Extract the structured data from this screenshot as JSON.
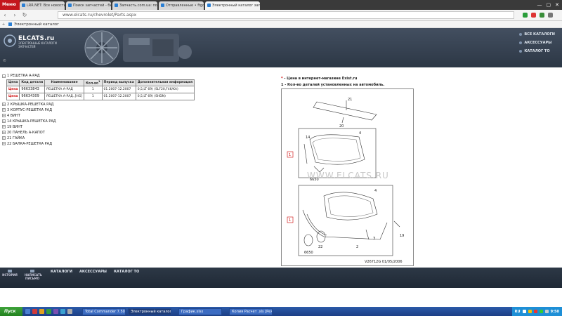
{
  "browser": {
    "brand": "Меню",
    "tabs": [
      {
        "label": "LRR.NET: Все новости м...",
        "active": false
      },
      {
        "label": "Поиск запчастей - быстрый...",
        "active": false
      },
      {
        "label": "Запчасть.com.ua: поисков...",
        "active": false
      },
      {
        "label": "Отправленные • ftgd@ukr...",
        "active": false
      },
      {
        "label": "Электронный каталог запча...",
        "active": true
      }
    ],
    "url": "www.elcats.ru/chevrolet/Parts.aspx",
    "bookmark": "Электронный каталог"
  },
  "site": {
    "logo": "ELCATS.ru",
    "logo_sub_1": "ЭЛЕКТРОННЫЕ КАТАЛОГИ",
    "logo_sub_2": "ЗАПЧАСТЕЙ",
    "copyright": "©",
    "top_menu": [
      "ВСЕ КАТАЛОГИ",
      "АКСЕССУАРЫ",
      "КАТАЛОГ ТО"
    ]
  },
  "tree": {
    "expanded_group": "1 РЕШЕТКА А-РАД",
    "table_headers": [
      "Цена",
      "Код детали",
      "Наименование",
      "Кол-во",
      "Период выпуска",
      "Дополнительная информация"
    ],
    "qty_superscript": "1",
    "rows": [
      {
        "price": "Цена",
        "code": "96633843",
        "name": "РЕШЕТКА А-РАД",
        "qty": "1",
        "period": "01.2007-12.2007",
        "info": "0,5,LT 69) (SLF20,F46/KA)"
      },
      {
        "price": "Цена",
        "code": "96634309",
        "name": "РЕШЕТКА А-РАД.,[НG]",
        "qty": "1",
        "period": "01.2007-12.2007",
        "info": "0,5,LT 69) (SHDN)"
      }
    ],
    "groups": [
      "2 КРЫШКА-РЕШЕТКА РАД",
      "3 КОРПУС-РЕШЕТКА РАД",
      "4 ВИНТ",
      "14 КРЫШКА-РЕШЕТКА РАД",
      "19 ВИНТ",
      "20 ПАНЕЛЬ А-КАПОТ",
      "21 ГАЙКА",
      "22 БАЛКА-РЕШЕТКА РАД"
    ]
  },
  "notes": {
    "note1_mark": "*",
    "note1": " - Цена в интернет-магазине Exist.ru",
    "note2_mark": "1",
    "note2": " - Кол-во деталей установленных на автомобиль."
  },
  "diagram": {
    "watermark": "WWW.ELCATS.RU",
    "labels": [
      "21",
      "20",
      "14",
      "4",
      "1",
      "6650",
      "4",
      "1",
      "19",
      "6650",
      "22",
      "2",
      "3"
    ],
    "footer": "V26712G  01/05/2006"
  },
  "footer": {
    "icons": [
      "ИСТОРИЯ",
      "НАПИСАТЬ ПИСЬМО"
    ],
    "menu": [
      "КАТАЛОГИ",
      "АКСЕССУАРЫ",
      "КАТАЛОГ ТО"
    ]
  },
  "taskbar": {
    "start": "Пуск",
    "tasks": [
      {
        "label": "Total Commander 7.50a ...",
        "active": false
      },
      {
        "label": "Электронный каталог...",
        "active": true
      },
      {
        "label": "График.xlsx",
        "active": false
      },
      {
        "label": "Копия Расчет .xls [Реж...",
        "active": false
      }
    ],
    "lang": "RU",
    "clock": "9:50"
  }
}
